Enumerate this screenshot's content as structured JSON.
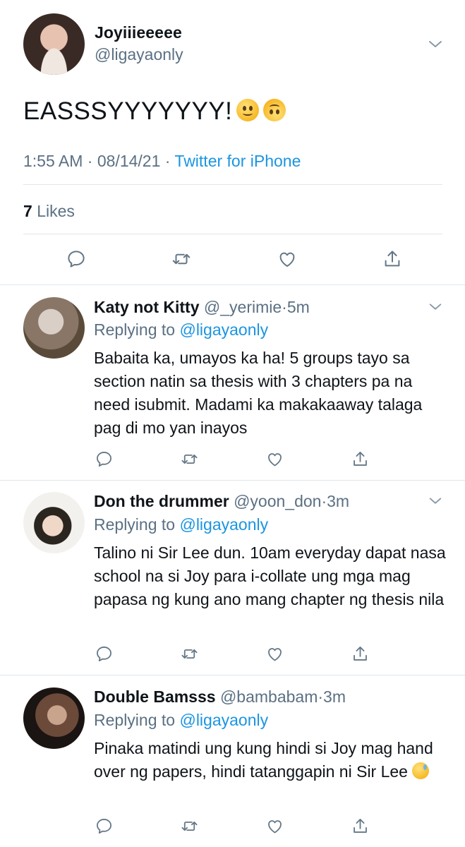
{
  "main_tweet": {
    "display_name": "Joyiiieeeee",
    "handle": "@ligayaonly",
    "text": "EASSSYYYYYYY!",
    "emojis": [
      "slightly-smiling-face",
      "upside-down-face"
    ],
    "meta": {
      "time": "1:55 AM",
      "date": "08/14/21",
      "separator": "·",
      "source": "Twitter for iPhone"
    },
    "likes": {
      "count": "7",
      "label": "Likes"
    }
  },
  "replies": [
    {
      "display_name": "Katy not Kitty",
      "handle": "@_yerimie",
      "time": "5m",
      "replying_to_label": "Replying to",
      "replying_to": "@ligayaonly",
      "body": "Babaita ka, umayos ka ha! 5 groups tayo sa section natin sa thesis with 3 chapters pa na need isubmit. Madami ka makakaaway talaga pag di mo yan inayos",
      "avatar_colors": [
        "#d9cfc7",
        "#5a4a3a"
      ]
    },
    {
      "display_name": "Don the drummer",
      "handle": "@yoon_don",
      "time": "3m",
      "replying_to_label": "Replying to",
      "replying_to": "@ligayaonly",
      "body": "Talino ni Sir Lee dun. 10am everyday dapat nasa school na si Joy para i-collate ung mga mag papasa ng kung ano mang chapter ng thesis nila",
      "avatar_colors": [
        "#f3f1ee",
        "#2b2520"
      ]
    },
    {
      "display_name": "Double Bamsss",
      "handle": "@bambabam",
      "time": "3m",
      "replying_to_label": "Replying to",
      "replying_to": "@ligayaonly",
      "body": "Pinaka matindi ung kung hindi si Joy mag hand over ng papers, hindi tatanggapin ni Sir Lee",
      "body_emoji": "grinning-face-with-sweat",
      "avatar_colors": [
        "#6b4a3a",
        "#1a1412"
      ]
    }
  ],
  "colors": {
    "text": "#0f1419",
    "secondary": "#5b7083",
    "link": "#1b95e0",
    "divider": "#e1e6ea"
  },
  "icons": [
    "chevron-down-icon",
    "reply-icon",
    "retweet-icon",
    "like-icon",
    "share-icon"
  ]
}
